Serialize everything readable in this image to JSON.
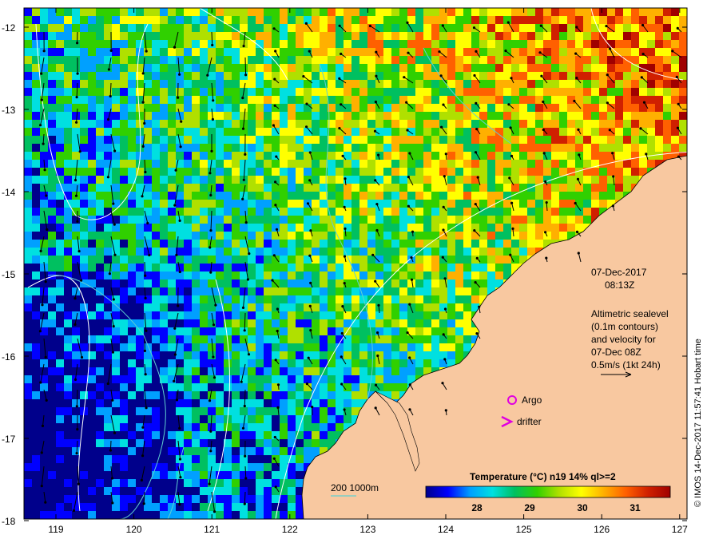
{
  "map": {
    "lat_ticks": [
      "-12",
      "-13",
      "-14",
      "-15",
      "-16",
      "-17",
      "-18"
    ],
    "lon_ticks": [
      "119",
      "120",
      "121",
      "122",
      "123",
      "124",
      "125",
      "126",
      "127"
    ],
    "date": "07-Dec-2017",
    "time": "08:13Z",
    "info_lines": [
      "Altimetric sealevel",
      "(0.1m contours)",
      "and velocity for",
      "07-Dec 08Z",
      "0.5m/s (1kt 24h)"
    ],
    "legend_argo": "Argo",
    "legend_drifter": "drifter",
    "bathy_label": "200  1000m",
    "colorbar": {
      "title": "Temperature (°C) n19 14% ql>=2",
      "ticks": [
        "28",
        "29",
        "30",
        "31"
      ],
      "gradient": [
        "#00008b",
        "#0000ff",
        "#00a0ff",
        "#00e0e0",
        "#00c060",
        "#30d000",
        "#b0e000",
        "#ffff00",
        "#ffb000",
        "#ff6000",
        "#d02000",
        "#a00000"
      ]
    },
    "credit": "© IMOS 14-Dec-2017 11:57:41 Hobart time",
    "colors": {
      "land": "#f8c8a0",
      "argo": "#e000e0",
      "drifter": "#e000e0",
      "contour": "#ffffff",
      "bathy": "#60d0d0"
    }
  }
}
